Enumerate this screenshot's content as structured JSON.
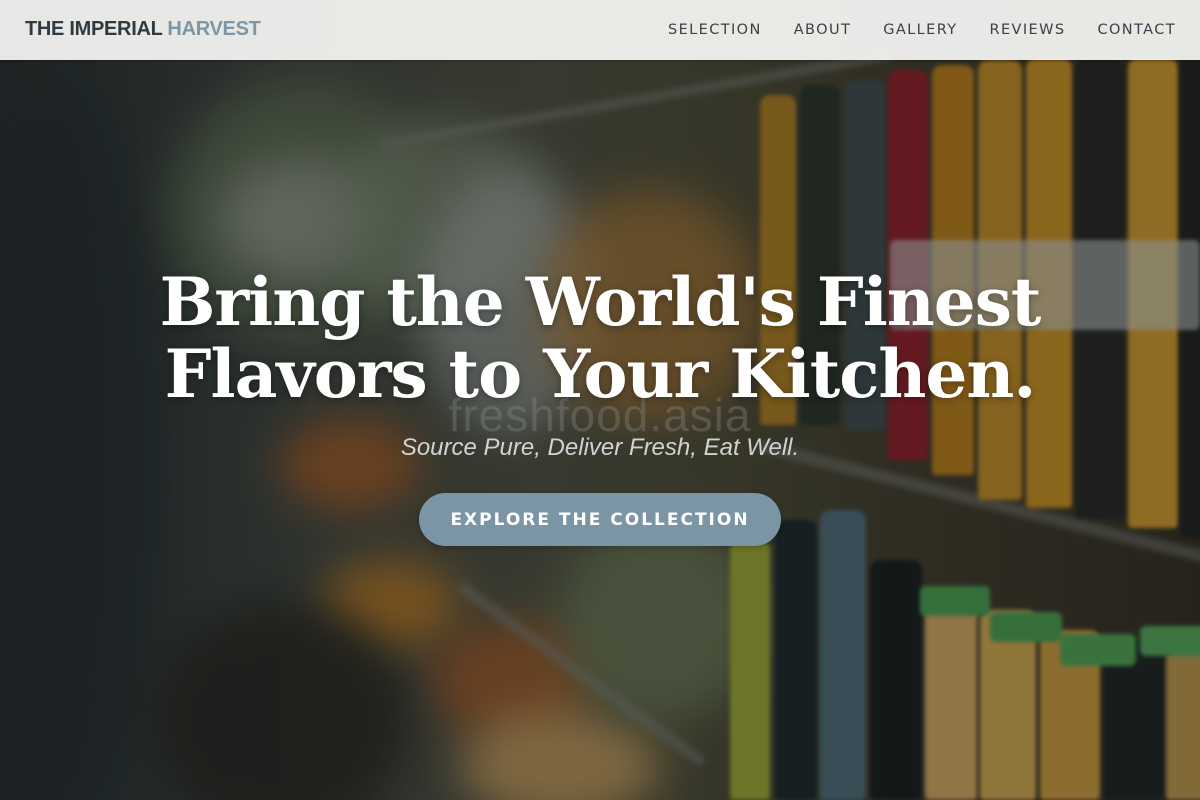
{
  "nav": {
    "brand_main": "THE IMPERIAL",
    "brand_accent": "HARVEST",
    "links": [
      {
        "label": "SELECTION"
      },
      {
        "label": "ABOUT"
      },
      {
        "label": "GALLERY"
      },
      {
        "label": "REVIEWS"
      },
      {
        "label": "CONTACT"
      }
    ]
  },
  "hero": {
    "headline_line1": "Bring the World's Finest",
    "headline_line2": "Flavors to Your Kitchen.",
    "watermark": "freshfood.asia",
    "tagline": "Source Pure, Deliver Fresh, Eat Well.",
    "cta_label": "EXPLORE THE COLLECTION"
  },
  "colors": {
    "brand_main": "#2f3a41",
    "brand_accent": "#7e97a6",
    "cta_background": "#7b95a5",
    "navbar_background": "#f4f4f2"
  }
}
